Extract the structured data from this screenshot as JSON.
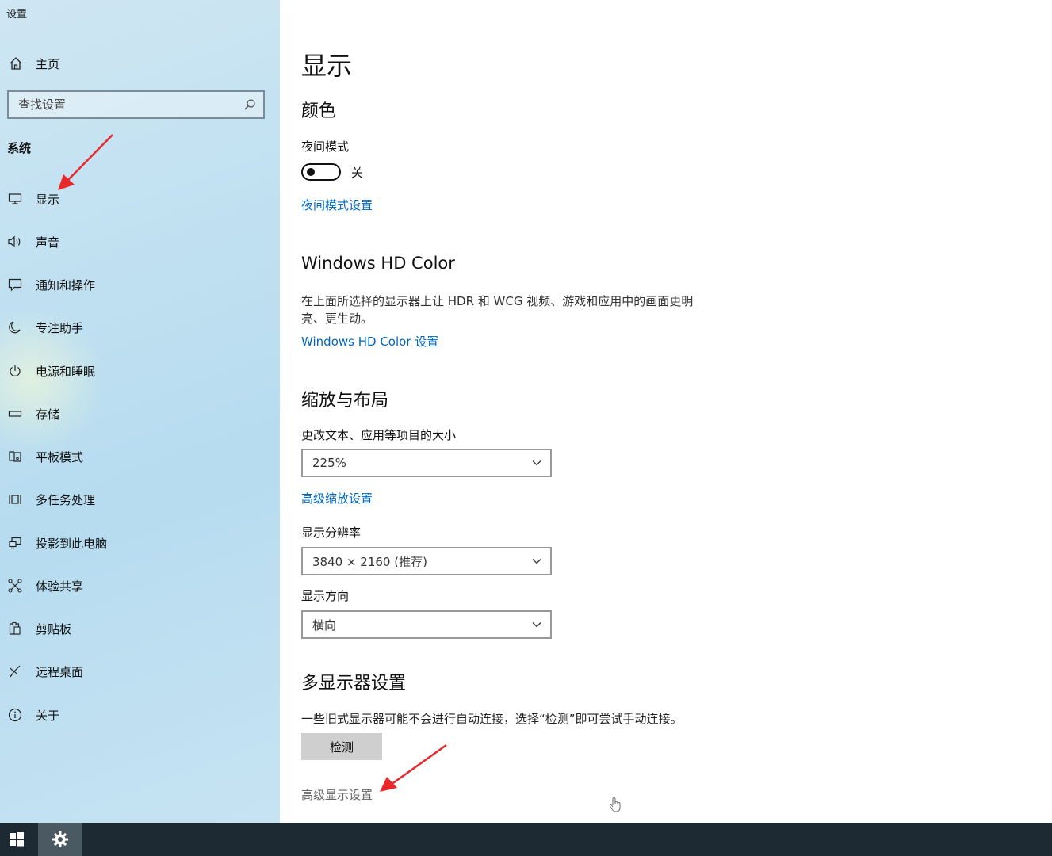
{
  "app": {
    "title": "设置"
  },
  "sidebar": {
    "home_label": "主页",
    "search_placeholder": "查找设置",
    "section_label": "系统",
    "items": [
      {
        "label": "显示",
        "icon": "monitor-icon"
      },
      {
        "label": "声音",
        "icon": "speaker-icon"
      },
      {
        "label": "通知和操作",
        "icon": "notification-icon"
      },
      {
        "label": "专注助手",
        "icon": "moon-icon"
      },
      {
        "label": "电源和睡眠",
        "icon": "power-icon"
      },
      {
        "label": "存储",
        "icon": "storage-icon"
      },
      {
        "label": "平板模式",
        "icon": "tablet-icon"
      },
      {
        "label": "多任务处理",
        "icon": "multitask-icon"
      },
      {
        "label": "投影到此电脑",
        "icon": "project-icon"
      },
      {
        "label": "体验共享",
        "icon": "share-icon"
      },
      {
        "label": "剪贴板",
        "icon": "clipboard-icon"
      },
      {
        "label": "远程桌面",
        "icon": "remote-icon"
      },
      {
        "label": "关于",
        "icon": "info-icon"
      }
    ]
  },
  "main": {
    "title": "显示",
    "color": {
      "heading": "颜色",
      "night_mode_label": "夜间模式",
      "night_mode_state": "关",
      "night_mode_on": false,
      "night_mode_link": "夜间模式设置"
    },
    "hd_color": {
      "heading": "Windows HD Color",
      "description": "在上面所选择的显示器上让 HDR 和 WCG 视频、游戏和应用中的画面更明亮、更生动。",
      "link": "Windows HD Color 设置"
    },
    "scale": {
      "heading": "缩放与布局",
      "size_label": "更改文本、应用等项目的大小",
      "size_value": "225%",
      "advanced_link": "高级缩放设置",
      "resolution_label": "显示分辨率",
      "resolution_value": "3840 × 2160 (推荐)",
      "orientation_label": "显示方向",
      "orientation_value": "横向"
    },
    "multi": {
      "heading": "多显示器设置",
      "description": "一些旧式显示器可能不会进行自动连接，选择“检测”即可尝试手动连接。",
      "detect_button": "检测",
      "advanced_display_link": "高级显示设置"
    }
  },
  "colors": {
    "accent_link": "#0067c0",
    "annotation_arrow": "#e8282b",
    "taskbar": "#1e2a33"
  }
}
